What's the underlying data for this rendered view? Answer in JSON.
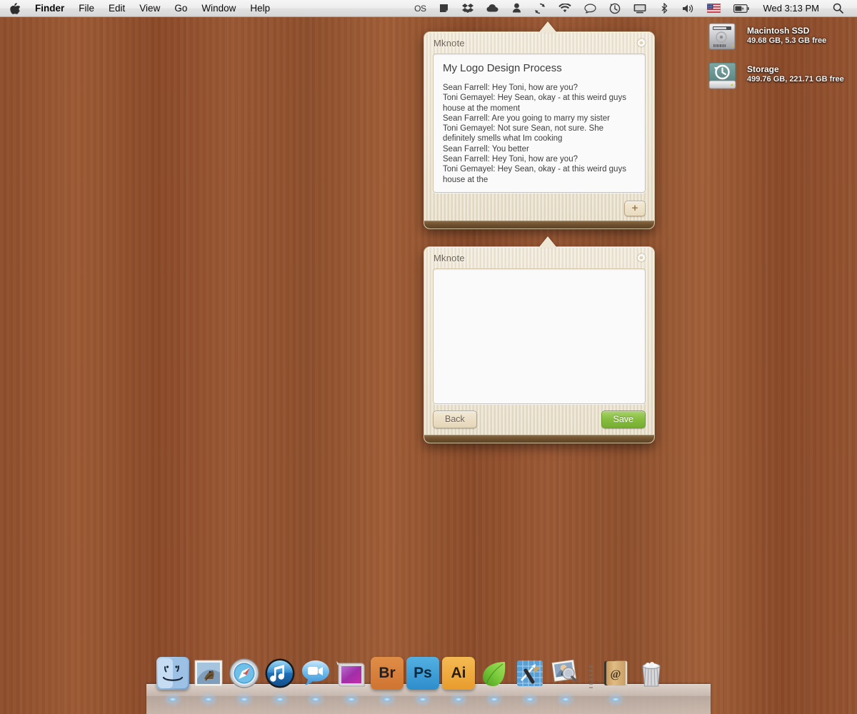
{
  "menubar": {
    "apple_icon": "apple-logo-icon",
    "items": [
      {
        "label": "Finder",
        "bold": true
      },
      {
        "label": "File",
        "bold": false
      },
      {
        "label": "Edit",
        "bold": false
      },
      {
        "label": "View",
        "bold": false
      },
      {
        "label": "Go",
        "bold": false
      },
      {
        "label": "Window",
        "bold": false
      },
      {
        "label": "Help",
        "bold": false
      }
    ],
    "status_icons": [
      {
        "name": "os-text-icon",
        "glyph": "OS"
      },
      {
        "name": "evernote-icon",
        "glyph": ""
      },
      {
        "name": "dropbox-icon",
        "glyph": ""
      },
      {
        "name": "cloud-icon",
        "glyph": ""
      },
      {
        "name": "user-account-icon",
        "glyph": ""
      },
      {
        "name": "sync-refresh-icon",
        "glyph": ""
      },
      {
        "name": "wifi-icon",
        "glyph": ""
      },
      {
        "name": "chat-bubble-icon",
        "glyph": ""
      },
      {
        "name": "time-machine-icon",
        "glyph": ""
      },
      {
        "name": "display-screen-icon",
        "glyph": ""
      },
      {
        "name": "bluetooth-icon",
        "glyph": ""
      },
      {
        "name": "volume-icon",
        "glyph": ""
      },
      {
        "name": "us-flag-input-icon",
        "glyph": ""
      },
      {
        "name": "battery-icon",
        "glyph": ""
      }
    ],
    "clock": "Wed 3:13 PM",
    "search_icon": "spotlight-search-icon"
  },
  "drives": [
    {
      "icon": "hard-drive-icon",
      "name": "Macintosh SSD",
      "info": "49.68 GB, 5.3 GB free"
    },
    {
      "icon": "time-machine-drive-icon",
      "name": "Storage",
      "info": "499.76 GB, 221.71 GB free"
    }
  ],
  "widget_note": {
    "title": "Mknote",
    "gear_icon": "gear-settings-icon",
    "note_heading": "My Logo Design Process",
    "lines": [
      "Sean Farrell:  Hey Toni, how are you?",
      "Toni Gemayel:  Hey Sean, okay - at this weird guys house at the moment",
      "Sean Farrell:  Are you going to marry my sister",
      "Toni Gemayel:  Not sure Sean, not sure.  She definitely smells what Im cooking",
      "Sean Farrell:  You better",
      "Sean Farrell:  Hey Toni, how are you?",
      "Toni Gemayel:  Hey Sean, okay - at this weird guys house at the"
    ],
    "add_button_label": "+",
    "add_button_icon": "plus-icon"
  },
  "widget_editor": {
    "title": "Mknote",
    "gear_icon": "gear-settings-icon",
    "textarea_value": "",
    "textarea_placeholder": "",
    "back_label": "Back",
    "save_label": "Save"
  },
  "dock": {
    "items": [
      {
        "name": "finder",
        "label": "Finder",
        "type": "finder"
      },
      {
        "name": "mail",
        "label": "Mail",
        "type": "mail"
      },
      {
        "name": "safari",
        "label": "Safari",
        "type": "safari"
      },
      {
        "name": "itunes",
        "label": "iTunes",
        "type": "itunes"
      },
      {
        "name": "facetime",
        "label": "FaceTime",
        "type": "facetime"
      },
      {
        "name": "aperture",
        "label": "Aperture",
        "type": "aperture"
      },
      {
        "name": "bridge",
        "label": "Br",
        "type": "adobe",
        "color": "#d87f3a",
        "text": "Br",
        "textcolor": "#231f20"
      },
      {
        "name": "photoshop",
        "label": "Ps",
        "type": "adobe",
        "color": "#3a9fd8",
        "text": "Ps",
        "textcolor": "#0b2a3f"
      },
      {
        "name": "illustrator",
        "label": "Ai",
        "type": "adobe",
        "color": "#efab3c",
        "text": "Ai",
        "textcolor": "#2b1c05"
      },
      {
        "name": "coda",
        "label": "Coda",
        "type": "coda"
      },
      {
        "name": "xcode",
        "label": "Xcode",
        "type": "xcode"
      },
      {
        "name": "iphoto",
        "label": "iPhoto",
        "type": "iphoto"
      },
      {
        "name": "separator",
        "label": "",
        "type": "separator"
      },
      {
        "name": "address-book",
        "label": "Address Book",
        "type": "addressbook"
      },
      {
        "name": "trash",
        "label": "Trash",
        "type": "trash"
      }
    ]
  },
  "colors": {
    "desktop_wood": "#94532f",
    "widget_cream": "#ece4d1",
    "widget_rim": "#6d4f2e",
    "save_green": "#86bd3f",
    "menubar_bg": "#ededed"
  }
}
